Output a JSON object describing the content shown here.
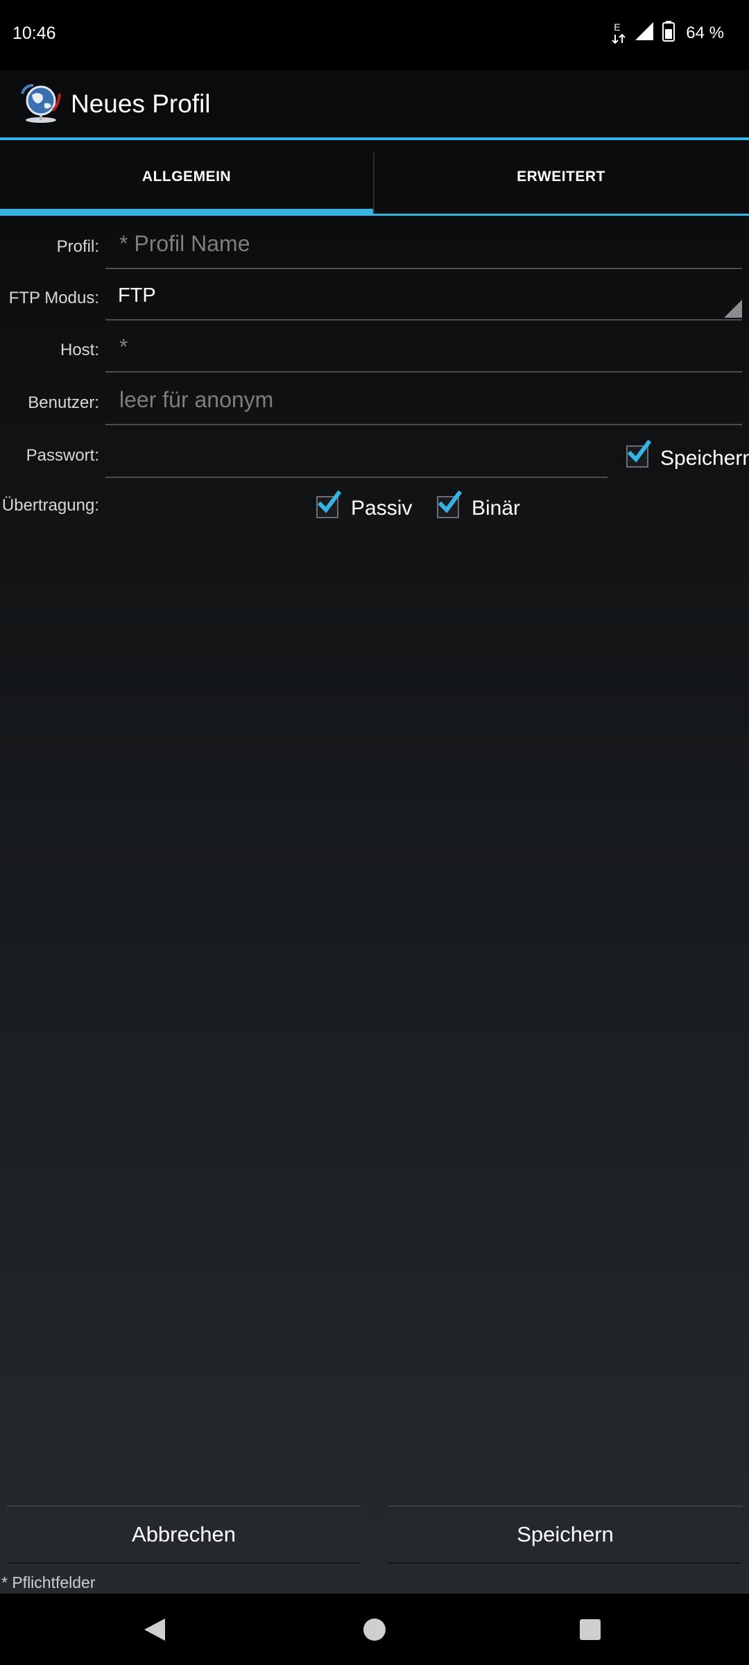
{
  "status_bar": {
    "time": "10:46",
    "network_label": "E",
    "battery": "64 %",
    "icons": [
      "data-arrows-icon",
      "signal-icon",
      "battery-icon"
    ]
  },
  "app_bar": {
    "title": "Neues Profil",
    "logo_icon": "globe-ftp-logo-icon"
  },
  "tabs": [
    {
      "label": "ALLGEMEIN",
      "active": true
    },
    {
      "label": "ERWEITERT",
      "active": false
    }
  ],
  "form": {
    "profile": {
      "label": "Profil:",
      "value": "",
      "placeholder": "* Profil Name"
    },
    "ftp_mode": {
      "label": "FTP Modus:",
      "value": "FTP"
    },
    "host": {
      "label": "Host:",
      "value": "",
      "placeholder": "*"
    },
    "user": {
      "label": "Benutzer:",
      "value": "",
      "placeholder": "leer für anonym"
    },
    "password": {
      "label": "Passwort:",
      "value": "",
      "save_label": "Speichern",
      "save_checked": true
    },
    "transfer": {
      "label": "Übertragung:",
      "passive_label": "Passiv",
      "passive_checked": true,
      "binary_label": "Binär",
      "binary_checked": true
    }
  },
  "buttons": {
    "cancel": "Abbrechen",
    "save": "Speichern"
  },
  "footnote": "* Pflichtfelder",
  "colors": {
    "accent": "#33b5e5",
    "background": "#000000"
  }
}
